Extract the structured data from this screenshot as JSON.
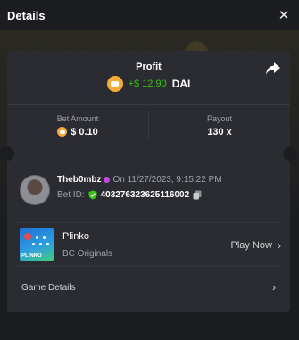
{
  "header": {
    "title": "Details",
    "close_glyph": "✕"
  },
  "profit": {
    "label": "Profit",
    "value": "+$ 12.90",
    "currency": "DAI",
    "value_color": "#3bc117",
    "coin_icon": "dai-coin-icon",
    "share_icon": "share-arrow-icon"
  },
  "bet": {
    "amount_label": "Bet Amount",
    "amount_value": "$ 0.10",
    "payout_label": "Payout",
    "payout_value": "130 x"
  },
  "user": {
    "name": "Theb0mbz",
    "timestamp": "On 11/27/2023, 9:15:22 PM",
    "bet_id_label": "Bet ID:",
    "bet_id": "403276323625116002"
  },
  "game": {
    "name": "Plinko",
    "provider": "BC Originals",
    "thumb_tag": "PLINKO",
    "play_now_label": "Play Now",
    "chevron_glyph": "›"
  },
  "game_details": {
    "label": "Game Details",
    "chevron_glyph": "›"
  },
  "colors": {
    "background": "#1c1d20",
    "card": "#2b2c31",
    "coin": "#f5ac37",
    "verified": "#3bc117"
  }
}
